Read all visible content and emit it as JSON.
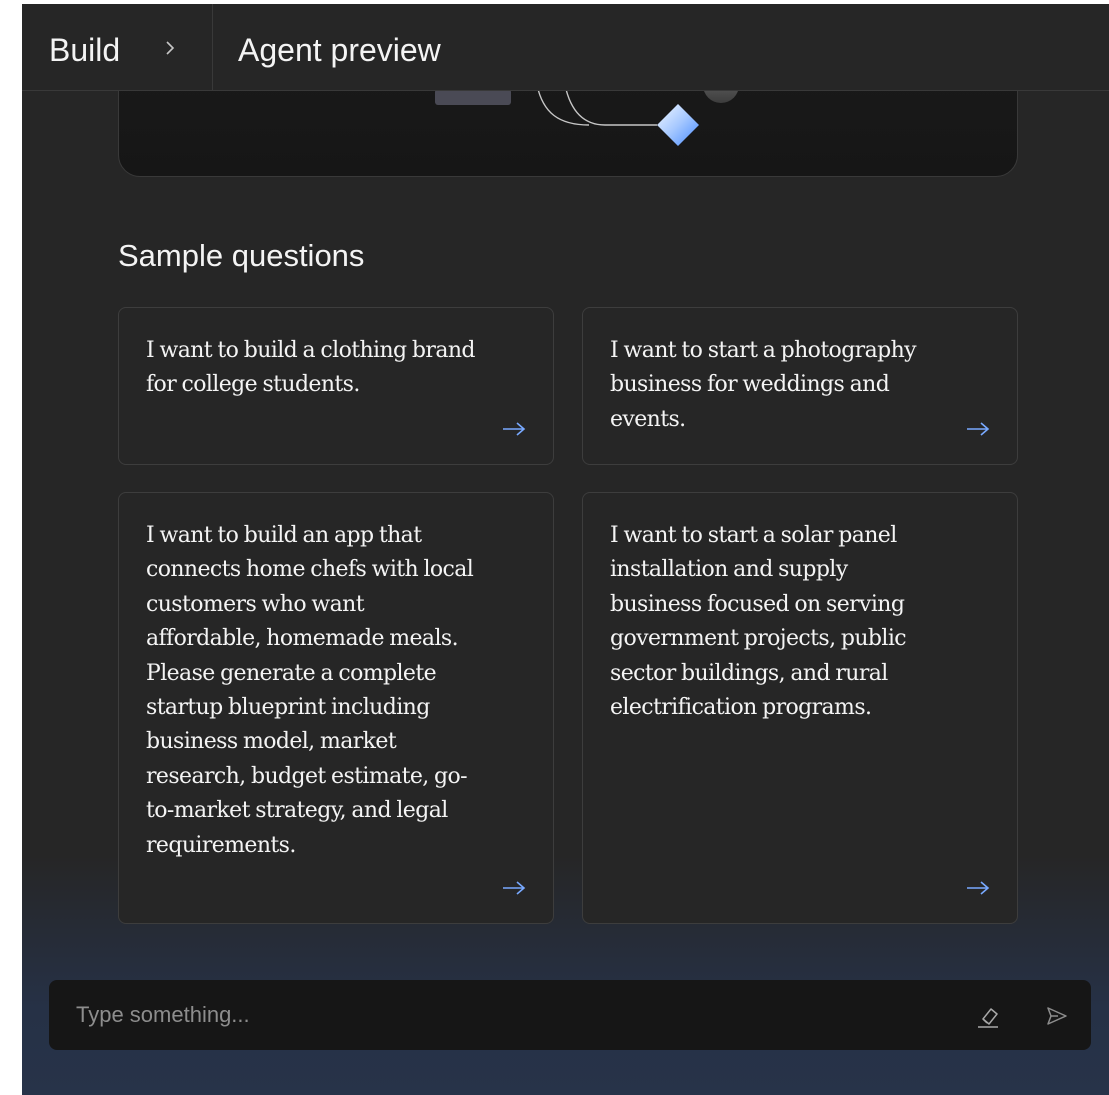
{
  "header": {
    "breadcrumb_root": "Build",
    "title": "Agent preview"
  },
  "sample_questions": {
    "heading": "Sample questions",
    "items": [
      {
        "text": "I want to build a clothing brand for college students."
      },
      {
        "text": "I want to start a photography business for weddings and events."
      },
      {
        "text": "I want to build an app that connects home chefs with local customers who want affordable, homemade meals. Please generate a complete startup blueprint including business model, market research, budget estimate, go-to-market strategy, and legal requirements."
      },
      {
        "text": "I want to start a solar panel installation and supply business focused on serving government projects, public sector buildings, and rural electrification programs."
      }
    ]
  },
  "composer": {
    "placeholder": "Type something...",
    "value": ""
  },
  "icons": {
    "breadcrumb_separator": "chevron-right-icon",
    "card_arrow": "arrow-right-icon",
    "erase": "eraser-icon",
    "send": "send-icon"
  },
  "colors": {
    "background": "#262626",
    "accent_arrow": "#78a9ff",
    "text_primary": "#f4f4f4",
    "placeholder": "#8d8d8d"
  }
}
